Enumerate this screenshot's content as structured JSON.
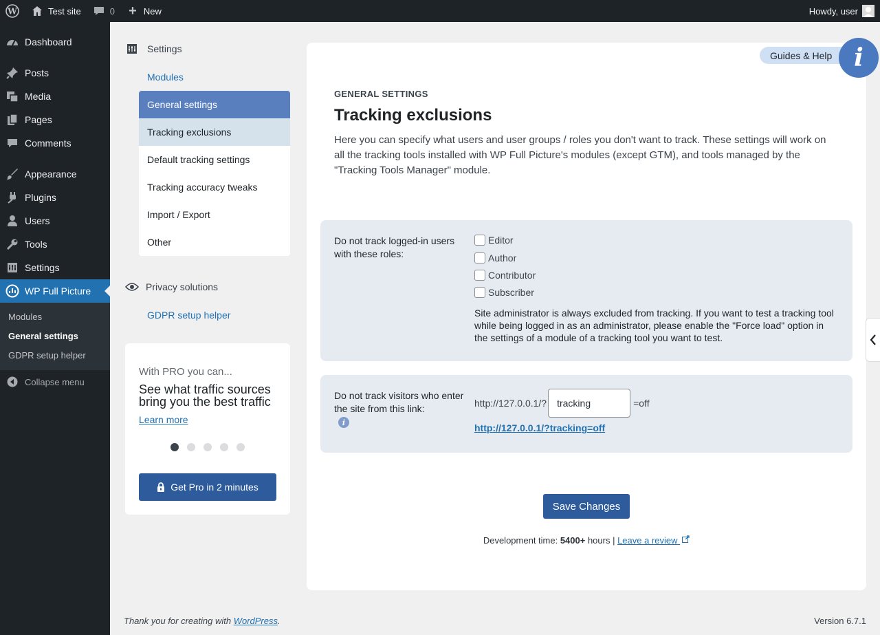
{
  "admin_bar": {
    "site_name": "Test site",
    "comments_count": "0",
    "new_label": "New",
    "howdy": "Howdy, user"
  },
  "side_menu": {
    "items": [
      {
        "label": "Dashboard",
        "icon": "dashboard-icon"
      },
      {
        "label": "Posts",
        "icon": "pin-icon"
      },
      {
        "label": "Media",
        "icon": "media-icon"
      },
      {
        "label": "Pages",
        "icon": "pages-icon"
      },
      {
        "label": "Comments",
        "icon": "comment-icon"
      },
      {
        "label": "Appearance",
        "icon": "brush-icon"
      },
      {
        "label": "Plugins",
        "icon": "plugin-icon"
      },
      {
        "label": "Users",
        "icon": "user-icon"
      },
      {
        "label": "Tools",
        "icon": "wrench-icon"
      },
      {
        "label": "Settings",
        "icon": "settings-icon"
      },
      {
        "label": "WP Full Picture",
        "icon": "chart-circle-icon"
      }
    ],
    "submenu": [
      "Modules",
      "General settings",
      "GDPR setup helper"
    ],
    "collapse": "Collapse menu"
  },
  "plugin_nav": {
    "settings_heading": "Settings",
    "modules_link": "Modules",
    "items": [
      "General settings",
      "Tracking exclusions",
      "Default tracking settings",
      "Tracking accuracy tweaks",
      "Import / Export",
      "Other"
    ],
    "privacy_heading": "Privacy solutions",
    "gdpr_link": "GDPR setup helper"
  },
  "pro_box": {
    "intro": "With PRO you can...",
    "line1": "See what traffic sources",
    "line2": "bring you the best traffic",
    "learn_more": "Learn more",
    "button": "Get Pro in 2 minutes",
    "active_dot": 1,
    "dot_count": 5
  },
  "main": {
    "guides": "Guides & Help",
    "info_glyph": "i",
    "eyebrow": "GENERAL SETTINGS",
    "title": "Tracking exclusions",
    "description": "Here you can specify what users and user groups / roles you don't want to track. These settings will work on all the tracking tools installed with WP Full Picture's modules (except GTM), and tools managed by the \"Tracking Tools Manager\" module.",
    "roles_panel": {
      "label": "Do not track logged-in users with these roles:",
      "roles": [
        "Editor",
        "Author",
        "Contributor",
        "Subscriber"
      ],
      "note": "Site administrator is always excluded from tracking. If you want to test a tracking tool while being logged in as an administrator, please enable the \"Force load\" option in the settings of a module of a tracking tool you want to test."
    },
    "link_panel": {
      "label": "Do not track visitors who enter the site from this link:",
      "prefix": "http://127.0.0.1/?",
      "param_value": "tracking",
      "suffix": "=off",
      "full_link": "http://127.0.0.1/?tracking=off"
    },
    "save": "Save Changes",
    "dev_prefix": "Development time: ",
    "dev_hours": "5400+",
    "dev_suffix": " hours | ",
    "review": "Leave a review"
  },
  "footer": {
    "thanks_prefix": "Thank you for creating with ",
    "wordpress": "WordPress",
    "thanks_suffix": ".",
    "version": "Version 6.7.1"
  },
  "colors": {
    "admin_dark": "#1d2327",
    "accent_blue": "#2271b1",
    "button_blue": "#2e5b9b",
    "nav_active": "#5a7fbe",
    "panel_bg": "#e6ebf1"
  }
}
